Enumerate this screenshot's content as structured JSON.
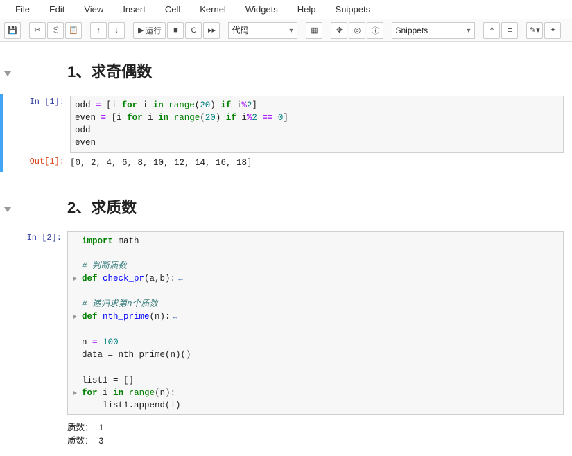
{
  "menu": {
    "items": [
      "File",
      "Edit",
      "View",
      "Insert",
      "Cell",
      "Kernel",
      "Widgets",
      "Help",
      "Snippets"
    ]
  },
  "toolbar": {
    "run_label": "运行",
    "celltype_value": "代码",
    "snippets_value": "Snippets"
  },
  "cells": {
    "h1": "1、求奇偶数",
    "in1_prompt": "In  [1]:",
    "in1_code_tokens": true,
    "out1_prompt": "Out[1]:",
    "out1_text": "[0, 2, 4, 6, 8, 10, 12, 14, 16, 18]",
    "h2": "2、求质数",
    "in2_prompt": "In  [2]:",
    "in2_tokens": true,
    "stdout2_l1": "质数： 1",
    "stdout2_l2": "质数： 3"
  },
  "code1": {
    "l1": {
      "var1": "odd",
      "eq": "=",
      "lb": "[",
      "i": "i",
      "kw_for": "for",
      "kw_in": "in",
      "range": "range",
      "lp": "(",
      "n20": "20",
      "rp": ")",
      "kw_if": "if",
      "mod": "%",
      "n2": "2",
      "rb": "]"
    },
    "l2": {
      "var1": "even",
      "eq": "=",
      "lb": "[",
      "i": "i",
      "kw_for": "for",
      "kw_in": "in",
      "range": "range",
      "lp": "(",
      "n20": "20",
      "rp": ")",
      "kw_if": "if",
      "mod": "%",
      "n2": "2",
      "eqeq": "==",
      "n0": "0",
      "rb": "]"
    },
    "l3": "odd",
    "l4": "even"
  },
  "code2": {
    "l1_import": "import",
    "l1_math": "math",
    "l2_comment": "# 判断质数",
    "l3_def": "def",
    "l3_fn": "check_pr",
    "l3_args": "(a,b):",
    "l4_comment": "# 递归求第n个质数",
    "l5_def": "def",
    "l5_fn": "nth_prime",
    "l5_args": "(n):",
    "l6_n": "n",
    "l6_eq": "=",
    "l6_100": "100",
    "l7": "data = nth_prime(n)()",
    "l8": "list1 = []",
    "l9_for": "for",
    "l9_i": "i",
    "l9_in": "in",
    "l9_range": "range",
    "l9_n": "(n):",
    "l10": "    list1.append(i)"
  }
}
